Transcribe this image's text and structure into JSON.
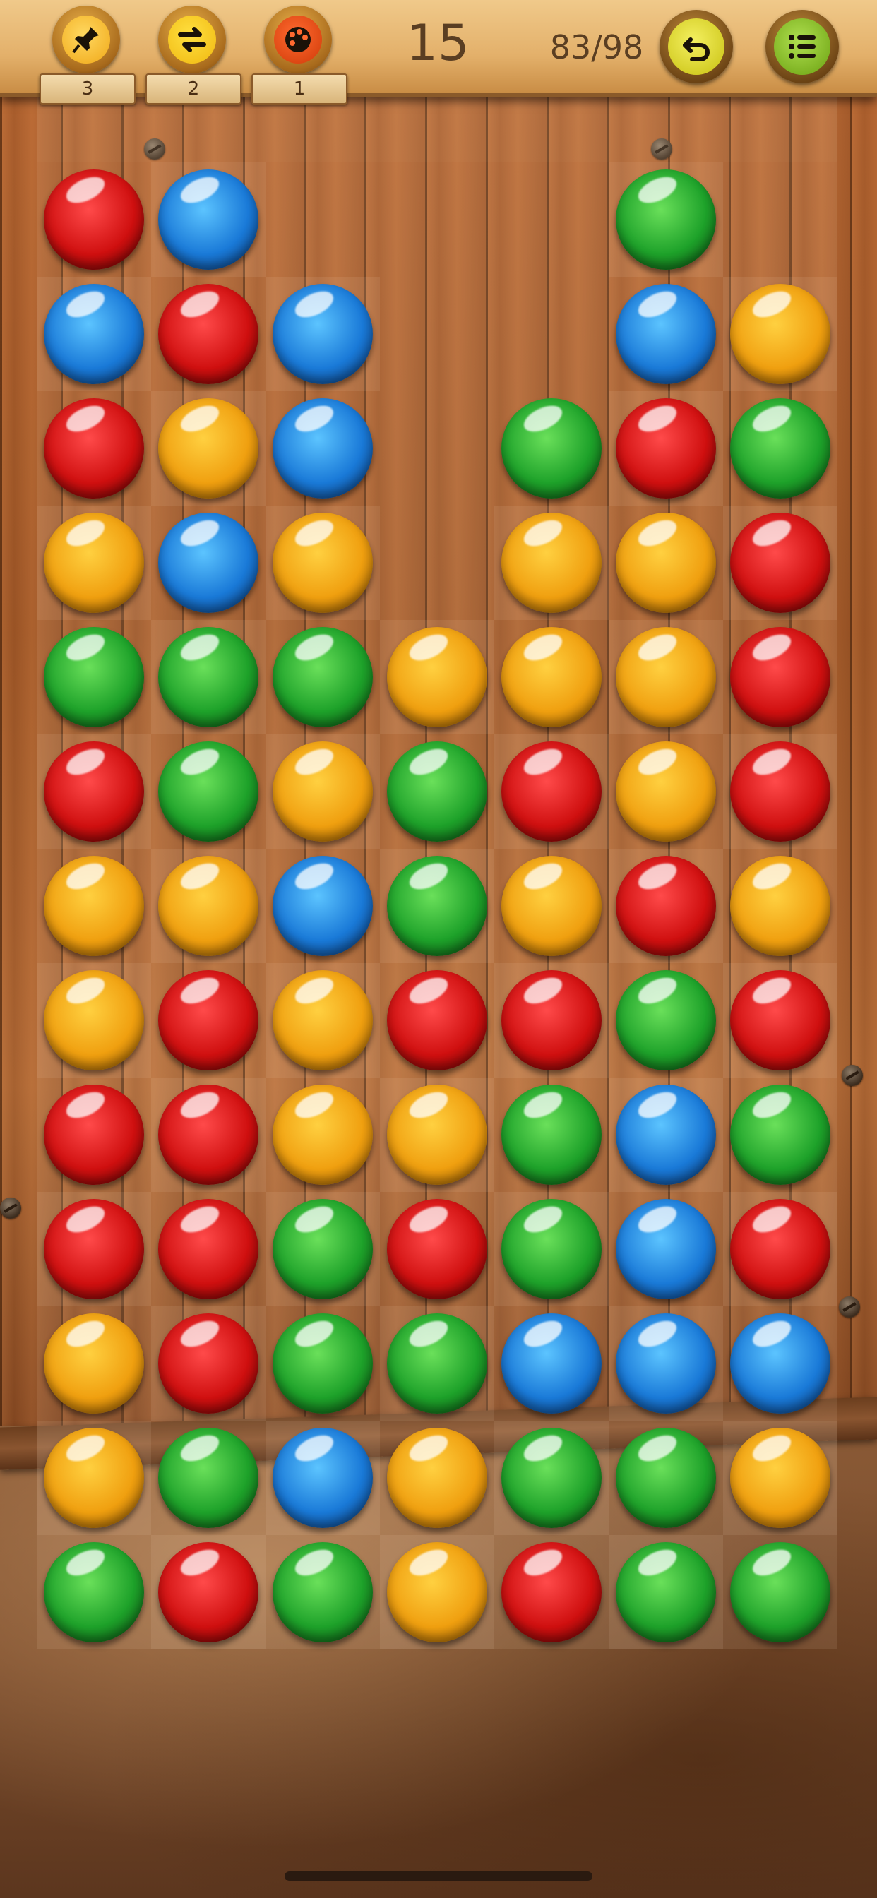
{
  "hud": {
    "powerups": [
      {
        "name": "pin-icon",
        "count": "3"
      },
      {
        "name": "swap-icon",
        "count": "2"
      },
      {
        "name": "palette-icon",
        "count": "1"
      }
    ],
    "moves": "15",
    "progress": "83/98",
    "undo_icon": "undo-icon",
    "menu_icon": "menu-icon"
  },
  "colors": {
    "red": "#d01010",
    "blue": "#1a7ad8",
    "green": "#1ea22a",
    "orange": "#f0a010"
  },
  "board": {
    "columns": 7,
    "rows": [
      [
        "",
        "",
        "",
        "",
        "",
        "",
        ""
      ],
      [
        "red",
        "blue",
        "",
        "",
        "",
        "green",
        ""
      ],
      [
        "blue",
        "red",
        "blue",
        "",
        "",
        "blue",
        "orange"
      ],
      [
        "red",
        "orange",
        "blue",
        "",
        "green",
        "red",
        "green"
      ],
      [
        "orange",
        "blue",
        "orange",
        "",
        "orange",
        "orange",
        "red"
      ],
      [
        "green",
        "green",
        "green",
        "orange",
        "orange",
        "orange",
        "red"
      ],
      [
        "red",
        "green",
        "orange",
        "green",
        "red",
        "orange",
        "red"
      ],
      [
        "orange",
        "orange",
        "blue",
        "green",
        "orange",
        "red",
        "orange"
      ],
      [
        "orange",
        "red",
        "orange",
        "red",
        "red",
        "green",
        "red"
      ],
      [
        "red",
        "red",
        "orange",
        "orange",
        "green",
        "blue",
        "green"
      ],
      [
        "red",
        "red",
        "green",
        "red",
        "green",
        "blue",
        "red"
      ],
      [
        "orange",
        "red",
        "green",
        "green",
        "blue",
        "blue",
        "blue"
      ],
      [
        "orange",
        "green",
        "blue",
        "orange",
        "green",
        "green",
        "orange"
      ],
      [
        "green",
        "red",
        "green",
        "orange",
        "red",
        "green",
        "green"
      ]
    ]
  }
}
